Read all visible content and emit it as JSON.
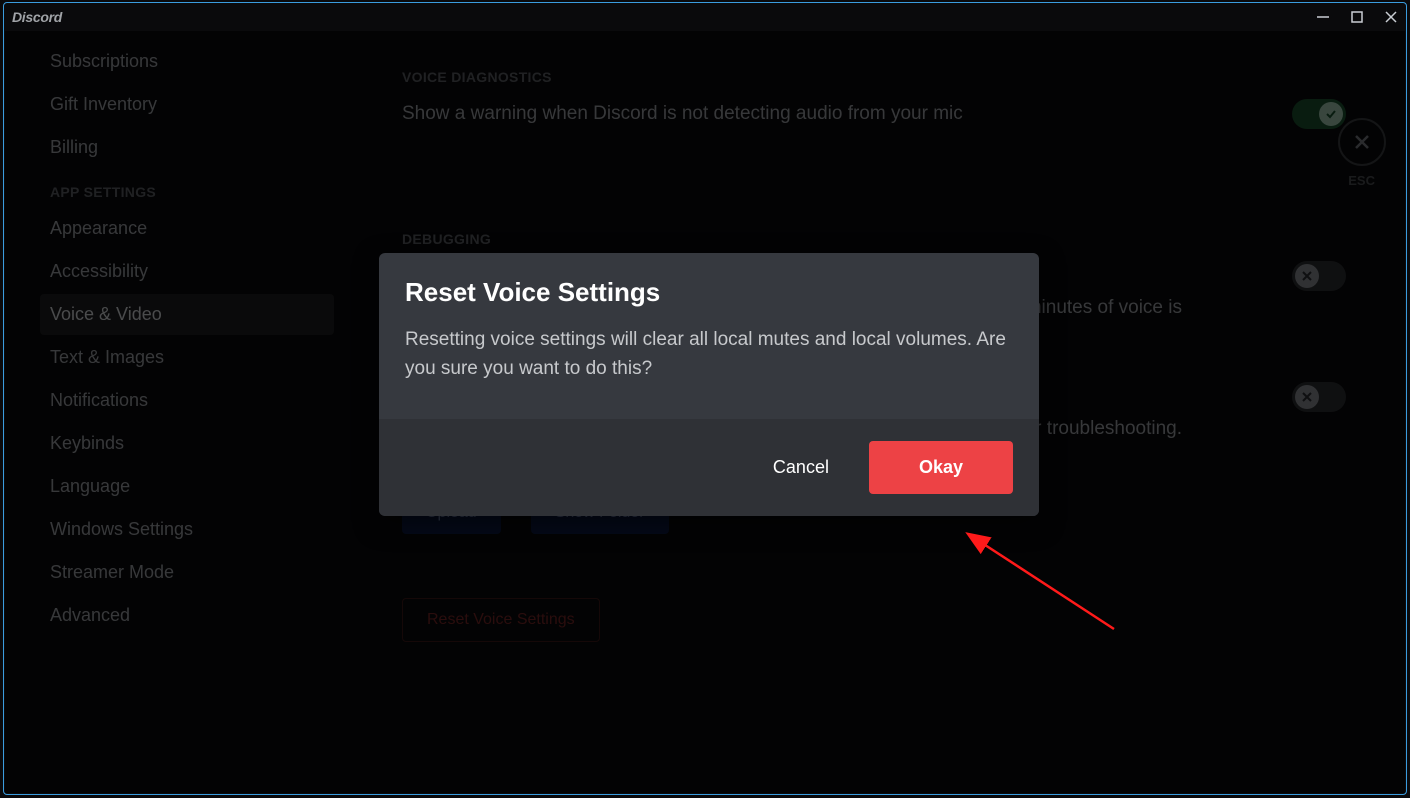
{
  "app": {
    "title": "Discord"
  },
  "sidebar": {
    "items_top": [
      {
        "label": "Subscriptions"
      },
      {
        "label": "Gift Inventory"
      },
      {
        "label": "Billing"
      }
    ],
    "section_header": "APP SETTINGS",
    "items_app": [
      {
        "label": "Appearance"
      },
      {
        "label": "Accessibility"
      },
      {
        "label": "Voice & Video",
        "selected": true
      },
      {
        "label": "Text & Images"
      },
      {
        "label": "Notifications"
      },
      {
        "label": "Keybinds"
      },
      {
        "label": "Language"
      },
      {
        "label": "Windows Settings"
      },
      {
        "label": "Streamer Mode"
      },
      {
        "label": "Advanced"
      }
    ]
  },
  "main": {
    "section_diagnostics": "VOICE DIAGNOSTICS",
    "diagnostics_text": "Show a warning when Discord is not detecting audio from your mic",
    "section_debugging": "DEBUGGING",
    "debug_text_1": "five minutes of voice is",
    "debug_text_2": "upport for troubleshooting.",
    "upload_label": "Upload",
    "show_folder_label": "Show Folder",
    "reset_voice_label": "Reset Voice Settings",
    "esc_label": "ESC"
  },
  "modal": {
    "title": "Reset Voice Settings",
    "body": "Resetting voice settings will clear all local mutes and local volumes. Are you sure you want to do this?",
    "cancel": "Cancel",
    "okay": "Okay"
  }
}
